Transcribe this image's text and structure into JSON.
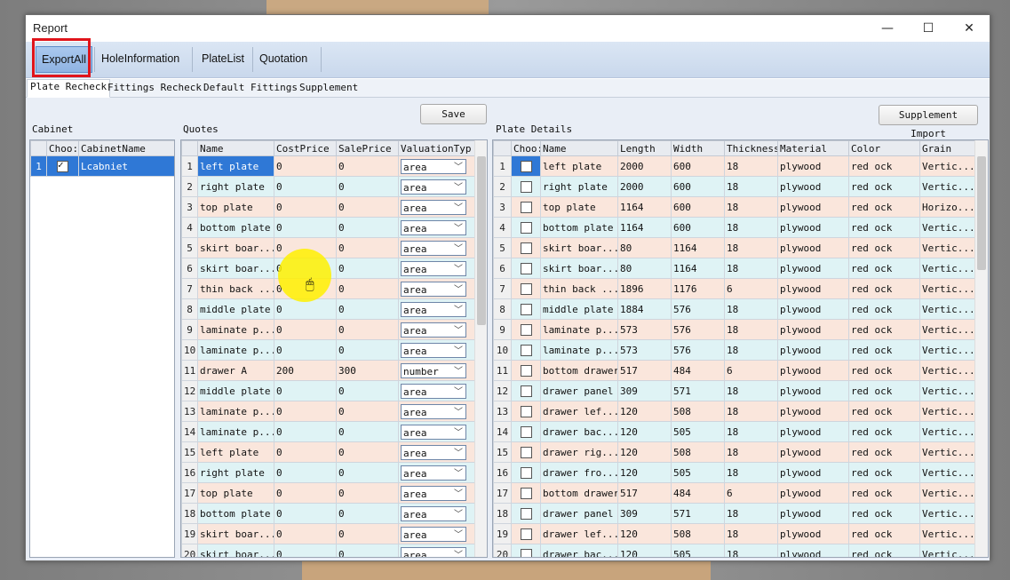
{
  "window": {
    "title": "Report",
    "controls": [
      "—",
      "☐",
      "✕"
    ]
  },
  "toolbar": {
    "buttons": [
      "ExportAll",
      "HoleInformation",
      "PlateList",
      "Quotation"
    ]
  },
  "tabs": [
    "Plate Recheck",
    "Fittings Recheck",
    "Default Fittings",
    "Supplement"
  ],
  "cabinet": {
    "label": "Cabinet",
    "headers": [
      "Choo:",
      "CabinetName"
    ],
    "rows": [
      {
        "num": "1",
        "name": "Lcabniet",
        "checked": true
      }
    ]
  },
  "quotes": {
    "label": "Quotes",
    "save_label": "Save",
    "headers": [
      "Name",
      "CostPrice",
      "SalePrice",
      "ValuationTyp"
    ],
    "rows": [
      [
        "1",
        "left plate",
        "0",
        "0",
        "area"
      ],
      [
        "2",
        "right plate",
        "0",
        "0",
        "area"
      ],
      [
        "3",
        "top plate",
        "0",
        "0",
        "area"
      ],
      [
        "4",
        "bottom plate",
        "0",
        "0",
        "area"
      ],
      [
        "5",
        "skirt boar...",
        "0",
        "0",
        "area"
      ],
      [
        "6",
        "skirt boar...",
        "0",
        "0",
        "area"
      ],
      [
        "7",
        "thin back ...",
        "0",
        "0",
        "area"
      ],
      [
        "8",
        "middle plate",
        "0",
        "0",
        "area"
      ],
      [
        "9",
        "laminate p...",
        "0",
        "0",
        "area"
      ],
      [
        "10",
        "laminate p...",
        "0",
        "0",
        "area"
      ],
      [
        "11",
        "drawer A",
        "200",
        "300",
        "number"
      ],
      [
        "12",
        "middle plate",
        "0",
        "0",
        "area"
      ],
      [
        "13",
        "laminate p...",
        "0",
        "0",
        "area"
      ],
      [
        "14",
        "laminate p...",
        "0",
        "0",
        "area"
      ],
      [
        "15",
        "left plate",
        "0",
        "0",
        "area"
      ],
      [
        "16",
        "right plate",
        "0",
        "0",
        "area"
      ],
      [
        "17",
        "top plate",
        "0",
        "0",
        "area"
      ],
      [
        "18",
        "bottom plate",
        "0",
        "0",
        "area"
      ],
      [
        "19",
        "skirt boar...",
        "0",
        "0",
        "area"
      ],
      [
        "20",
        "skirt boar...",
        "0",
        "0",
        "area"
      ]
    ]
  },
  "plates": {
    "label": "Plate Details",
    "import_label": "Supplement Import",
    "headers": [
      "Choo:",
      "Name",
      "Length",
      "Width",
      "Thickness",
      "Material",
      "Color",
      "Grain"
    ],
    "rows": [
      [
        "1",
        "left plate",
        "2000",
        "600",
        "18",
        "plywood",
        "red ock",
        "Vertic..."
      ],
      [
        "2",
        "right plate",
        "2000",
        "600",
        "18",
        "plywood",
        "red ock",
        "Vertic..."
      ],
      [
        "3",
        "top plate",
        "1164",
        "600",
        "18",
        "plywood",
        "red ock",
        "Horizo..."
      ],
      [
        "4",
        "bottom plate",
        "1164",
        "600",
        "18",
        "plywood",
        "red ock",
        "Vertic..."
      ],
      [
        "5",
        "skirt boar...",
        "80",
        "1164",
        "18",
        "plywood",
        "red ock",
        "Vertic..."
      ],
      [
        "6",
        "skirt boar...",
        "80",
        "1164",
        "18",
        "plywood",
        "red ock",
        "Vertic..."
      ],
      [
        "7",
        "thin back ...",
        "1896",
        "1176",
        "6",
        "plywood",
        "red ock",
        "Vertic..."
      ],
      [
        "8",
        "middle plate",
        "1884",
        "576",
        "18",
        "plywood",
        "red ock",
        "Vertic..."
      ],
      [
        "9",
        "laminate p...",
        "573",
        "576",
        "18",
        "plywood",
        "red ock",
        "Vertic..."
      ],
      [
        "10",
        "laminate p...",
        "573",
        "576",
        "18",
        "plywood",
        "red ock",
        "Vertic..."
      ],
      [
        "11",
        "bottom drawer",
        "517",
        "484",
        "6",
        "plywood",
        "red ock",
        "Vertic..."
      ],
      [
        "12",
        "drawer panel",
        "309",
        "571",
        "18",
        "plywood",
        "red ock",
        "Vertic..."
      ],
      [
        "13",
        "drawer lef...",
        "120",
        "508",
        "18",
        "plywood",
        "red ock",
        "Vertic..."
      ],
      [
        "14",
        "drawer bac...",
        "120",
        "505",
        "18",
        "plywood",
        "red ock",
        "Vertic..."
      ],
      [
        "15",
        "drawer rig...",
        "120",
        "508",
        "18",
        "plywood",
        "red ock",
        "Vertic..."
      ],
      [
        "16",
        "drawer fro...",
        "120",
        "505",
        "18",
        "plywood",
        "red ock",
        "Vertic..."
      ],
      [
        "17",
        "bottom drawer",
        "517",
        "484",
        "6",
        "plywood",
        "red ock",
        "Vertic..."
      ],
      [
        "18",
        "drawer panel",
        "309",
        "571",
        "18",
        "plywood",
        "red ock",
        "Vertic..."
      ],
      [
        "19",
        "drawer lef...",
        "120",
        "508",
        "18",
        "plywood",
        "red ock",
        "Vertic..."
      ],
      [
        "20",
        "drawer bac...",
        "120",
        "505",
        "18",
        "plywood",
        "red ock",
        "Vertic..."
      ]
    ]
  }
}
